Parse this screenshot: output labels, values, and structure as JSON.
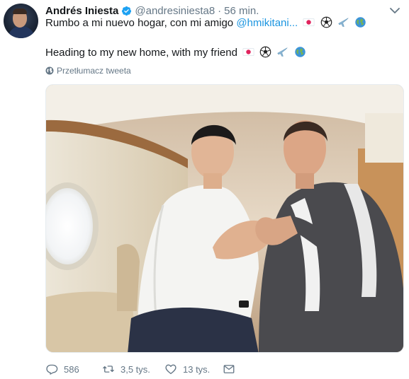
{
  "tweet": {
    "display_name": "Andrés Iniesta",
    "handle": "@andresiniesta8",
    "separator": "·",
    "time": "56 min.",
    "text_es_prefix": "Rumbo a mi nuevo hogar, con mi amigo ",
    "text_es_mention": "@hmikitani...",
    "text_en": "Heading to my new home, with my friend",
    "translate_label": "Przetłumacz tweeta",
    "emojis": [
      "japan-flag",
      "soccer-ball",
      "airplane",
      "globe-earth"
    ]
  },
  "actions": {
    "replies": "586",
    "retweets": "3,5 tys.",
    "likes": "13 tys."
  },
  "colors": {
    "link": "#1b95e0",
    "secondary": "#657786",
    "verified": "#1da1f2"
  }
}
